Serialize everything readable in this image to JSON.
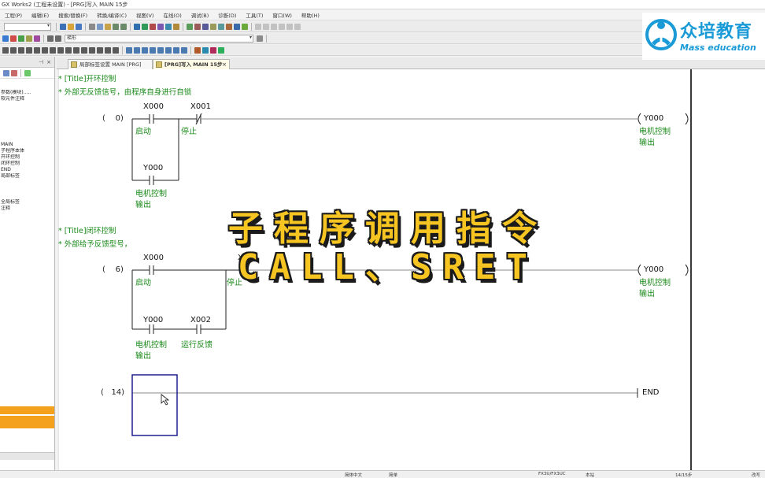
{
  "window": {
    "title": "GX Works2 (工程未设置) - [PRG]写入 MAIN 15步"
  },
  "menu": [
    "工程(P)",
    "编辑(E)",
    "搜索/替换(F)",
    "转换/编译(C)",
    "视图(V)",
    "在线(O)",
    "调试(B)",
    "诊断(D)",
    "工具(T)",
    "窗口(W)",
    "帮助(H)"
  ],
  "toolbar": {
    "combo1": "",
    "combo2": "梯形"
  },
  "left_panel": {
    "items": [
      "",
      "",
      "",
      "",
      "",
      "",
      "",
      "",
      "",
      "",
      "",
      "",
      "",
      "参数(模块).....",
      "软元件注释",
      "",
      "",
      "",
      "",
      "",
      "",
      "MAIN",
      "子程序本体",
      "开环控制",
      "闭环控制",
      "END",
      "局部标签",
      "",
      "",
      "",
      "",
      "",
      "全局标签",
      "注释"
    ]
  },
  "tabs": [
    {
      "label": "局部标签设置 MAIN [PRG]",
      "active": false
    },
    {
      "label": "[PRG]写入 MAIN 15步",
      "active": true
    }
  ],
  "ladder": {
    "block1": {
      "title_tag": "* [Title]",
      "title": "开环控制",
      "comment": "* 外部无反馈信号，由程序自身进行自锁",
      "step": "0)",
      "contact1": {
        "device": "X000",
        "note": "启动"
      },
      "contact2": {
        "device": "X001",
        "note": "停止"
      },
      "parallel": {
        "device": "Y000",
        "note1": "电机控制",
        "note2": "输出"
      },
      "coil": {
        "device": "Y000",
        "note1": "电机控制",
        "note2": "输出"
      }
    },
    "block2": {
      "title_tag": "* [Title]",
      "title": "闭环控制",
      "comment": "* 外部给予反馈型号，",
      "step": "6)",
      "contact1": {
        "device": "X000",
        "note": "启动"
      },
      "contact2": {
        "device": "X001",
        "note": "停止"
      },
      "parallel1": {
        "device": "Y000",
        "note1": "电机控制",
        "note2": "输出"
      },
      "parallel2": {
        "device": "X002",
        "note": "运行反馈"
      },
      "coil": {
        "device": "Y000",
        "note1": "电机控制",
        "note2": "输出"
      }
    },
    "block3": {
      "step": "14)",
      "end": "END"
    }
  },
  "overlay": {
    "line1": "子程序调用指令",
    "line2": "CALL、SRET"
  },
  "logo": {
    "cn": "众培教育",
    "en": "Mass education"
  },
  "status": {
    "lang": "简体中文",
    "mode": "简单",
    "plc": "FX3U/FX3UC",
    "station": "本站",
    "step": "14/15步",
    "ovr": "改写"
  },
  "colors": {
    "comment_green": "#1a8a1a",
    "overlay_yellow": "#f6c521",
    "logo_blue": "#1a9bd7",
    "cursor_box": "#1f1f8f",
    "left_orange": "#f4a21d"
  }
}
